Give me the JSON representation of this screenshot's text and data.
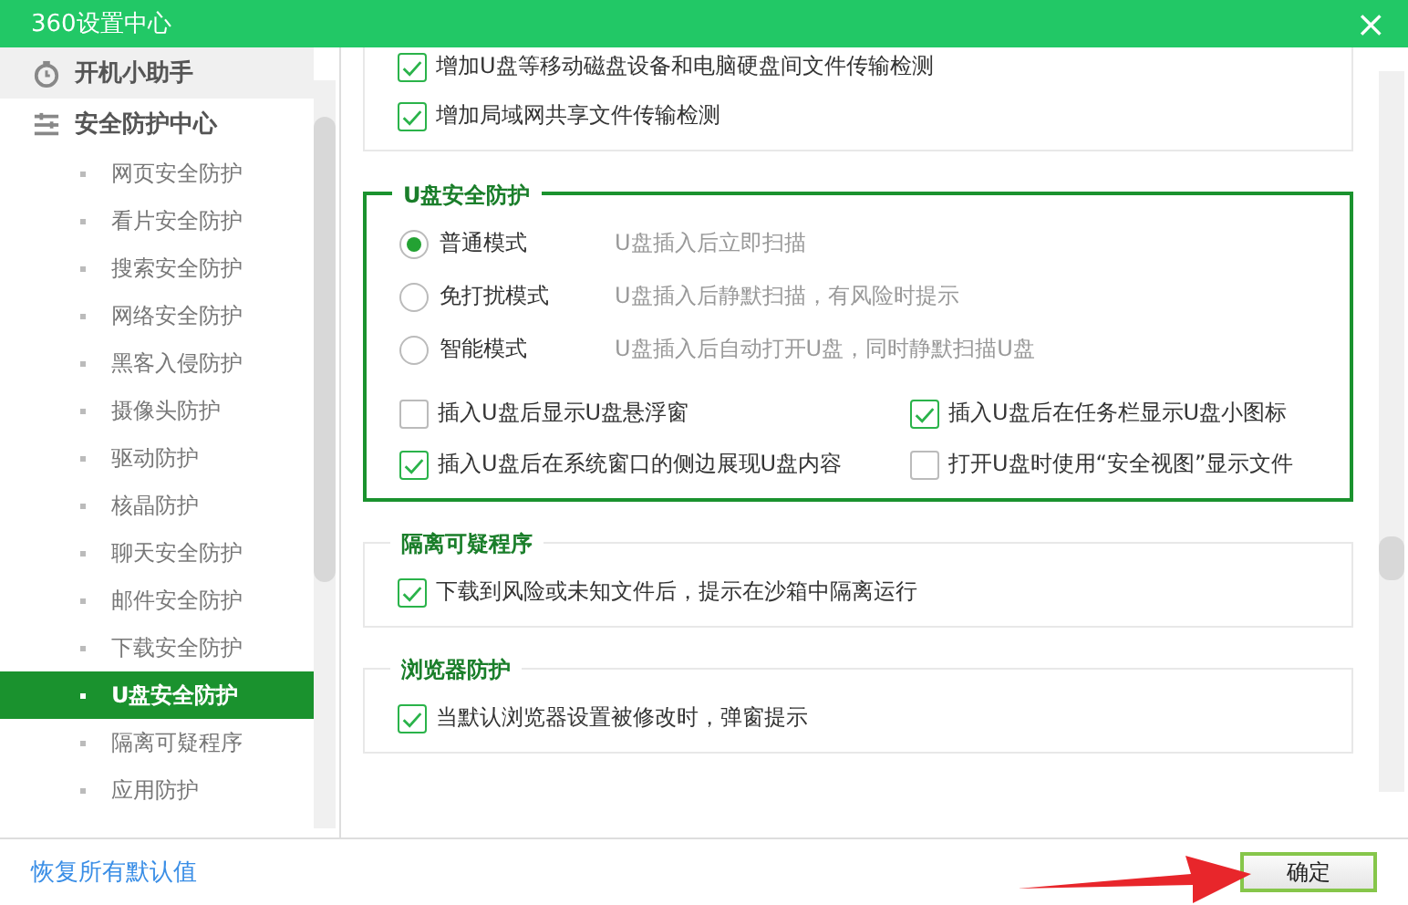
{
  "window": {
    "title": "360设置中心",
    "close": "×"
  },
  "sidebar": {
    "sections": [
      {
        "label": "开机小助手",
        "kind": "clock",
        "hovered": true
      },
      {
        "label": "安全防护中心",
        "kind": "list",
        "hovered": false,
        "children": [
          {
            "label": "网页安全防护",
            "selected": false
          },
          {
            "label": "看片安全防护",
            "selected": false
          },
          {
            "label": "搜索安全防护",
            "selected": false
          },
          {
            "label": "网络安全防护",
            "selected": false
          },
          {
            "label": "黑客入侵防护",
            "selected": false
          },
          {
            "label": "摄像头防护",
            "selected": false
          },
          {
            "label": "驱动防护",
            "selected": false
          },
          {
            "label": "核晶防护",
            "selected": false
          },
          {
            "label": "聊天安全防护",
            "selected": false
          },
          {
            "label": "邮件安全防护",
            "selected": false
          },
          {
            "label": "下载安全防护",
            "selected": false
          },
          {
            "label": "U盘安全防护",
            "selected": true
          },
          {
            "label": "隔离可疑程序",
            "selected": false
          },
          {
            "label": "应用防护",
            "selected": false
          }
        ]
      }
    ]
  },
  "groups": [
    {
      "active": false,
      "options": [
        {
          "label": "增加U盘等移动磁盘设备和电脑硬盘间文件传输检测",
          "checked": true
        },
        {
          "label": "增加局域网共享文件传输检测",
          "checked": true
        }
      ]
    },
    {
      "title": "U盘安全防护",
      "active": true,
      "modes": [
        {
          "label": "普通模式",
          "hint": "U盘插入后立即扫描",
          "selected": true
        },
        {
          "label": "免打扰模式",
          "hint": "U盘插入后静默扫描，有风险时提示",
          "selected": false
        },
        {
          "label": "智能模式",
          "hint": "U盘插入后自动打开U盘，同时静默扫描U盘",
          "selected": false
        }
      ],
      "options": [
        {
          "label": "插入U盘后显示U盘悬浮窗",
          "checked": false
        },
        {
          "label": "插入U盘后在任务栏显示U盘小图标",
          "checked": true
        },
        {
          "label": "插入U盘后在系统窗口的侧边展现U盘内容",
          "checked": true
        },
        {
          "label": "打开U盘时使用“安全视图”显示文件",
          "checked": false
        }
      ]
    },
    {
      "title": "隔离可疑程序",
      "active": false,
      "options": [
        {
          "label": "下载到风险或未知文件后，提示在沙箱中隔离运行",
          "checked": true
        }
      ]
    },
    {
      "title": "浏览器防护",
      "active": false,
      "options": [
        {
          "label": "当默认浏览器设置被修改时，弹窗提示",
          "checked": true
        }
      ]
    }
  ],
  "footer": {
    "reset_link": "恢复所有默认值",
    "ok_button": "确定"
  }
}
